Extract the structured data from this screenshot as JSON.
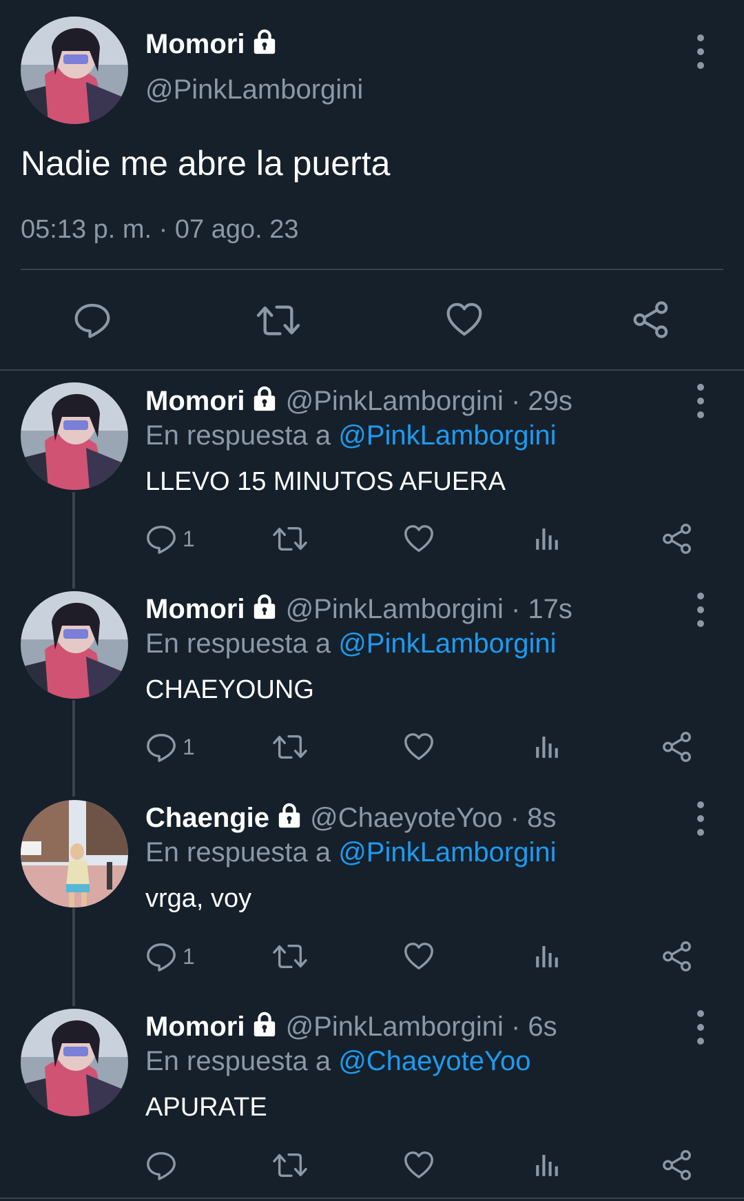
{
  "main_tweet": {
    "name": "Momori",
    "handle": "@PinkLamborgini",
    "text": "Nadie me abre la puerta",
    "timestamp": "05:13 p. m. · 07 ago. 23"
  },
  "replies": [
    {
      "name": "Momori",
      "handle": "@PinkLamborgini",
      "time": "· 29s",
      "reply_prefix": "En respuesta a ",
      "reply_to": "@PinkLamborgini",
      "text": "LLEVO 15 MINUTOS AFUERA",
      "reply_count": "1"
    },
    {
      "name": "Momori",
      "handle": "@PinkLamborgini",
      "time": "· 17s",
      "reply_prefix": "En respuesta a ",
      "reply_to": "@PinkLamborgini",
      "text": "CHAEYOUNG",
      "reply_count": "1"
    },
    {
      "name": "Chaengie",
      "handle": "@ChaeyoteYoo",
      "time": "· 8s",
      "reply_prefix": "En respuesta a ",
      "reply_to": "@PinkLamborgini",
      "text": "vrga, voy",
      "reply_count": "1"
    },
    {
      "name": "Momori",
      "handle": "@PinkLamborgini",
      "time": "· 6s",
      "reply_prefix": "En respuesta a ",
      "reply_to": "@ChaeyoteYoo",
      "text": "APURATE",
      "reply_count": ""
    }
  ],
  "icons": {
    "reply": "reply-icon",
    "retweet": "retweet-icon",
    "like": "heart-icon",
    "views": "views-icon",
    "share": "share-icon",
    "lock": "lock-icon",
    "more": "more-vertical-icon"
  },
  "colors": {
    "background": "#15202b",
    "text_primary": "#ffffff",
    "text_secondary": "#8b98a5",
    "link": "#1d9bf0",
    "divider": "#38444d"
  }
}
